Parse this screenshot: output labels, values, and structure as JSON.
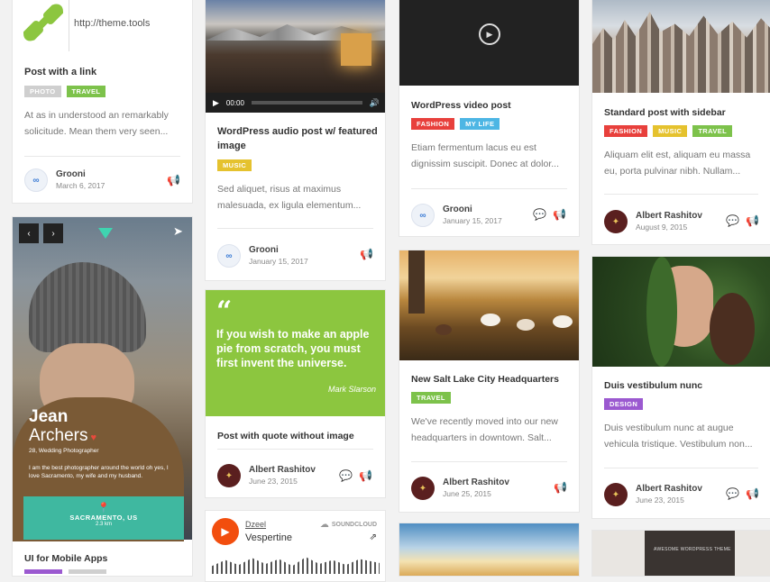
{
  "colors": {
    "photo": "#cfcfcf",
    "travel": "#7dc24b",
    "fashion": "#e8403c",
    "mylife": "#4db6e4",
    "music": "#e5c22e",
    "design": "#9b59d0",
    "quote": "#8cc63f"
  },
  "link_post": {
    "url": "http://theme.tools",
    "title": "Post with a link",
    "tags": [
      "PHOTO",
      "TRAVEL"
    ],
    "excerpt": "At as in understood an remarkably solicitude. Mean them very seen...",
    "author": "Grooni",
    "date": "March 6, 2017"
  },
  "mobile_post": {
    "first": "Jean",
    "last": "Archers",
    "role": "28, Wedding Photographer",
    "bio": "I am the best photographer around the world oh yes, I love Sacramento, my wife and my husband.",
    "city": "SACRAMENTO, US",
    "dist": "2.3 km",
    "title": "UI for Mobile Apps"
  },
  "audio_post": {
    "time": "00:00",
    "title": "WordPress audio post w/ featured image",
    "tags": [
      "MUSIC"
    ],
    "excerpt": "Sed aliquet, risus at maximus malesuada, ex ligula elementum...",
    "author": "Grooni",
    "date": "January 15, 2017"
  },
  "quote_post": {
    "mark": "“",
    "text": "If you wish to make an apple pie from scratch, you must first invent the universe.",
    "cite": "Mark Slarson",
    "title": "Post with quote without image",
    "author": "Albert Rashitov",
    "date": "June 23, 2015"
  },
  "soundcloud": {
    "user": "Dzeel",
    "track": "Vespertine",
    "brand": "SOUNDCLOUD"
  },
  "video_post": {
    "title": "WordPress video post",
    "tags": [
      "FASHION",
      "MY LIFE"
    ],
    "excerpt": "Etiam fermentum lacus eu est dignissim suscipit. Donec at dolor...",
    "author": "Grooni",
    "date": "January 15, 2017"
  },
  "slc_post": {
    "title": "New Salt Lake City Headquarters",
    "tags": [
      "TRAVEL"
    ],
    "excerpt": "We've recently moved into our new headquarters in downtown. Salt...",
    "author": "Albert Rashitov",
    "date": "June 25, 2015"
  },
  "sidebar_post": {
    "title": "Standard post with sidebar",
    "tags": [
      "FASHION",
      "MUSIC",
      "TRAVEL"
    ],
    "excerpt": "Aliquam elit est, aliquam eu massa eu, porta pulvinar nibh. Nullam...",
    "author": "Albert Rashitov",
    "date": "August 9, 2015"
  },
  "design_post": {
    "title": "Duis vestibulum nunc",
    "tags": [
      "DESIGN"
    ],
    "excerpt": "Duis vestibulum nunc at augue vehicula tristique. Vestibulum non...",
    "author": "Albert Rashitov",
    "date": "June 23, 2015"
  },
  "theme_shot": {
    "text": "AWESOME WORDPRESS THEME"
  }
}
